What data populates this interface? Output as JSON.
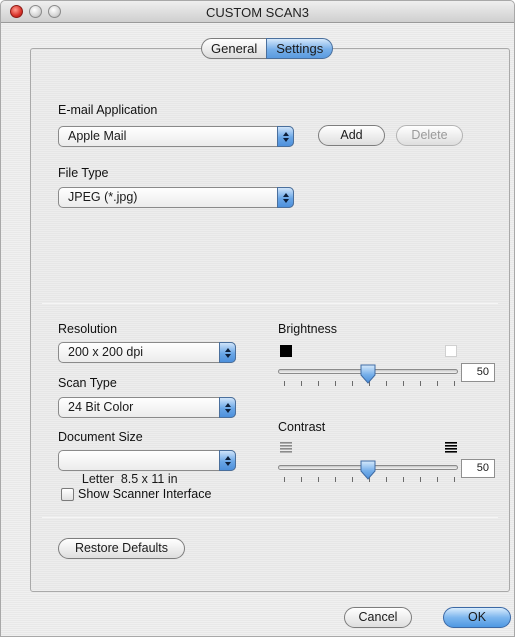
{
  "window": {
    "title": "CUSTOM SCAN3"
  },
  "tabs": [
    {
      "label": "General",
      "selected": false
    },
    {
      "label": "Settings",
      "selected": true
    }
  ],
  "email": {
    "label": "E-mail Application",
    "value": "Apple Mail",
    "add_label": "Add",
    "delete_label": "Delete"
  },
  "file_type": {
    "label": "File Type",
    "value": "JPEG (*.jpg)"
  },
  "resolution": {
    "label": "Resolution",
    "value": "200 x 200 dpi"
  },
  "scan_type": {
    "label": "Scan Type",
    "value": "24 Bit Color"
  },
  "document_size": {
    "label": "Document Size",
    "value": "Letter  8.5 x 11 in"
  },
  "scanner_interface": {
    "label": "Show Scanner Interface",
    "checked": false
  },
  "brightness": {
    "label": "Brightness",
    "value": "50"
  },
  "contrast": {
    "label": "Contrast",
    "value": "50"
  },
  "buttons": {
    "restore_defaults": "Restore Defaults",
    "cancel": "Cancel",
    "ok": "OK"
  },
  "colors": {
    "accent": "#5a9be0",
    "dark_swatch": "#000000",
    "light_swatch": "#ffffff"
  }
}
